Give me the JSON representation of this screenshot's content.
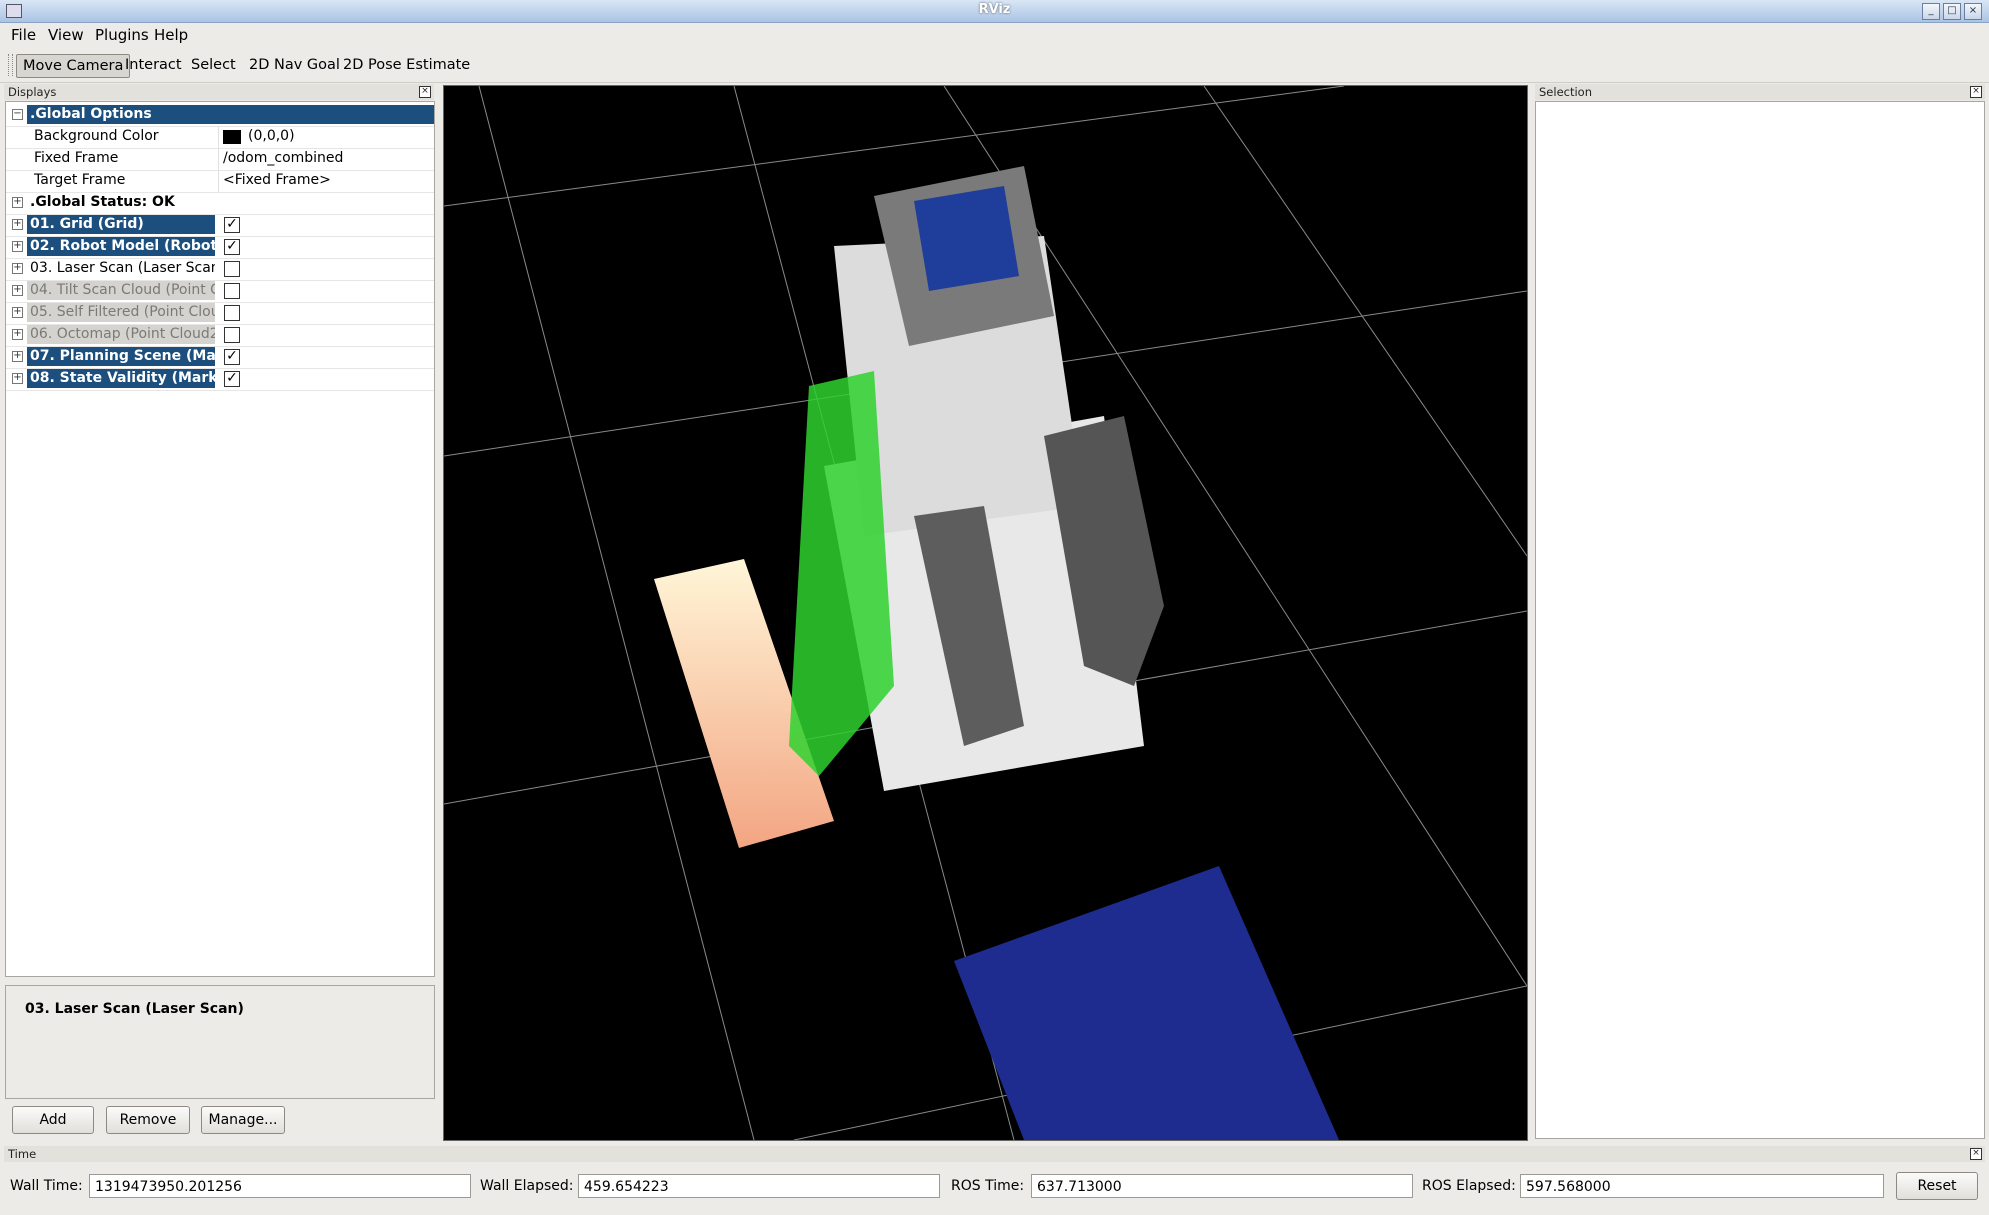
{
  "window": {
    "title": "RViz"
  },
  "menu": {
    "file": "File",
    "view": "View",
    "plugins": "Plugins",
    "help": "Help"
  },
  "toolbar": {
    "move_camera": "Move Camera",
    "interact": "Interact",
    "select": "Select",
    "nav_goal": "2D Nav Goal",
    "pose_estimate": "2D Pose Estimate"
  },
  "displays": {
    "title": "Displays",
    "global_options": ".Global Options",
    "props": [
      {
        "name": "Background Color",
        "value": "(0,0,0)"
      },
      {
        "name": "Fixed Frame",
        "value": "/odom_combined"
      },
      {
        "name": "Target Frame",
        "value": "<Fixed Frame>"
      }
    ],
    "global_status": ".Global Status: OK",
    "items": [
      {
        "label": "01. Grid (Grid)",
        "checked": true
      },
      {
        "label": "02. Robot Model (Robot",
        "checked": true
      },
      {
        "label": "03. Laser Scan (Laser Scan)",
        "checked": false
      },
      {
        "label": "04. Tilt Scan Cloud (Point Cl",
        "checked": false
      },
      {
        "label": "05. Self Filtered (Point Clouc",
        "checked": false
      },
      {
        "label": "06. Octomap (Point Cloud2)",
        "checked": false
      },
      {
        "label": "07. Planning Scene (Mar",
        "checked": true
      },
      {
        "label": "08. State Validity (Mark",
        "checked": true
      }
    ],
    "description_title": "03. Laser Scan (Laser Scan)",
    "add": "Add",
    "remove": "Remove",
    "manage": "Manage..."
  },
  "selection": {
    "title": "Selection"
  },
  "time": {
    "title": "Time",
    "wall_time_label": "Wall Time:",
    "wall_time": "1319473950.201256",
    "wall_elapsed_label": "Wall Elapsed:",
    "wall_elapsed": "459.654223",
    "ros_time_label": "ROS Time:",
    "ros_time": "637.713000",
    "ros_elapsed_label": "ROS Elapsed:",
    "ros_elapsed": "597.568000",
    "reset": "Reset"
  },
  "colors": {
    "selection_blue": "#1c4f7d",
    "background": "#000000"
  }
}
